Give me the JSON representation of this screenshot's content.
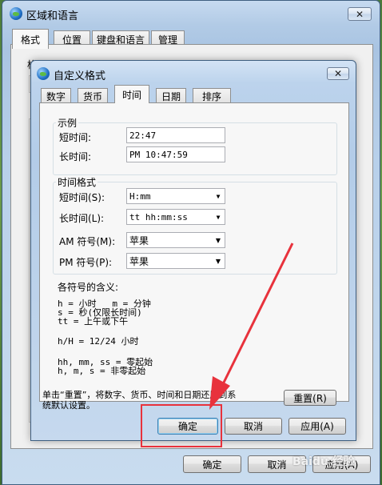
{
  "outer_window": {
    "title": "区域和语言",
    "close_glyph": "✕",
    "tabs": [
      {
        "label": "格式",
        "active": true
      },
      {
        "label": "位置",
        "active": false
      },
      {
        "label": "键盘和语言",
        "active": false
      },
      {
        "label": "管理",
        "active": false
      }
    ],
    "behind_label_fragment": "格",
    "buttons": {
      "ok": "确定",
      "cancel": "取消",
      "apply": "应用(A)"
    }
  },
  "dialog": {
    "title": "自定义格式",
    "close_glyph": "✕",
    "tabs": [
      {
        "label": "数字",
        "active": false
      },
      {
        "label": "货币",
        "active": false
      },
      {
        "label": "时间",
        "active": true
      },
      {
        "label": "日期",
        "active": false
      },
      {
        "label": "排序",
        "active": false
      }
    ],
    "examples_group": {
      "title": "示例",
      "short_time_label": "短时间:",
      "short_time_value": "22:47",
      "long_time_label": "长时间:",
      "long_time_value": "PM 10:47:59"
    },
    "formats_group": {
      "title": "时间格式",
      "short_time_label": "短时间(S):",
      "short_time_value": "H:mm",
      "long_time_label": "长时间(L):",
      "long_time_value": "tt hh:mm:ss",
      "am_label": "AM 符号(M):",
      "am_value": "苹果",
      "pm_label": "PM 符号(P):",
      "pm_value": "苹果"
    },
    "legend": {
      "heading": "各符号的含义:",
      "lines": [
        "h = 小时   m = 分钟",
        "s = 秒(仅限长时间)",
        "tt = 上午或下午",
        "h/H = 12/24 小时",
        "hh, mm, ss = 零起始",
        "h, m, s = 非零起始"
      ]
    },
    "reset_note": "单击“重置”，将数字、货币、时间和日期还原到系统默认设置。",
    "reset_note_line1": "单击“重置”，将数字、货币、时间和日期还原到系",
    "reset_note_line2": "统默认设置。",
    "buttons": {
      "reset": "重置(R)",
      "ok": "确定",
      "cancel": "取消",
      "apply": "应用(A)"
    }
  },
  "annotation": {
    "color": "#e8323c",
    "watermark": "Baidu 经验"
  },
  "colors": {
    "window_frame": "#b8d0ea",
    "panel": "#f0f0f0",
    "annotation_red": "#e8323c"
  }
}
